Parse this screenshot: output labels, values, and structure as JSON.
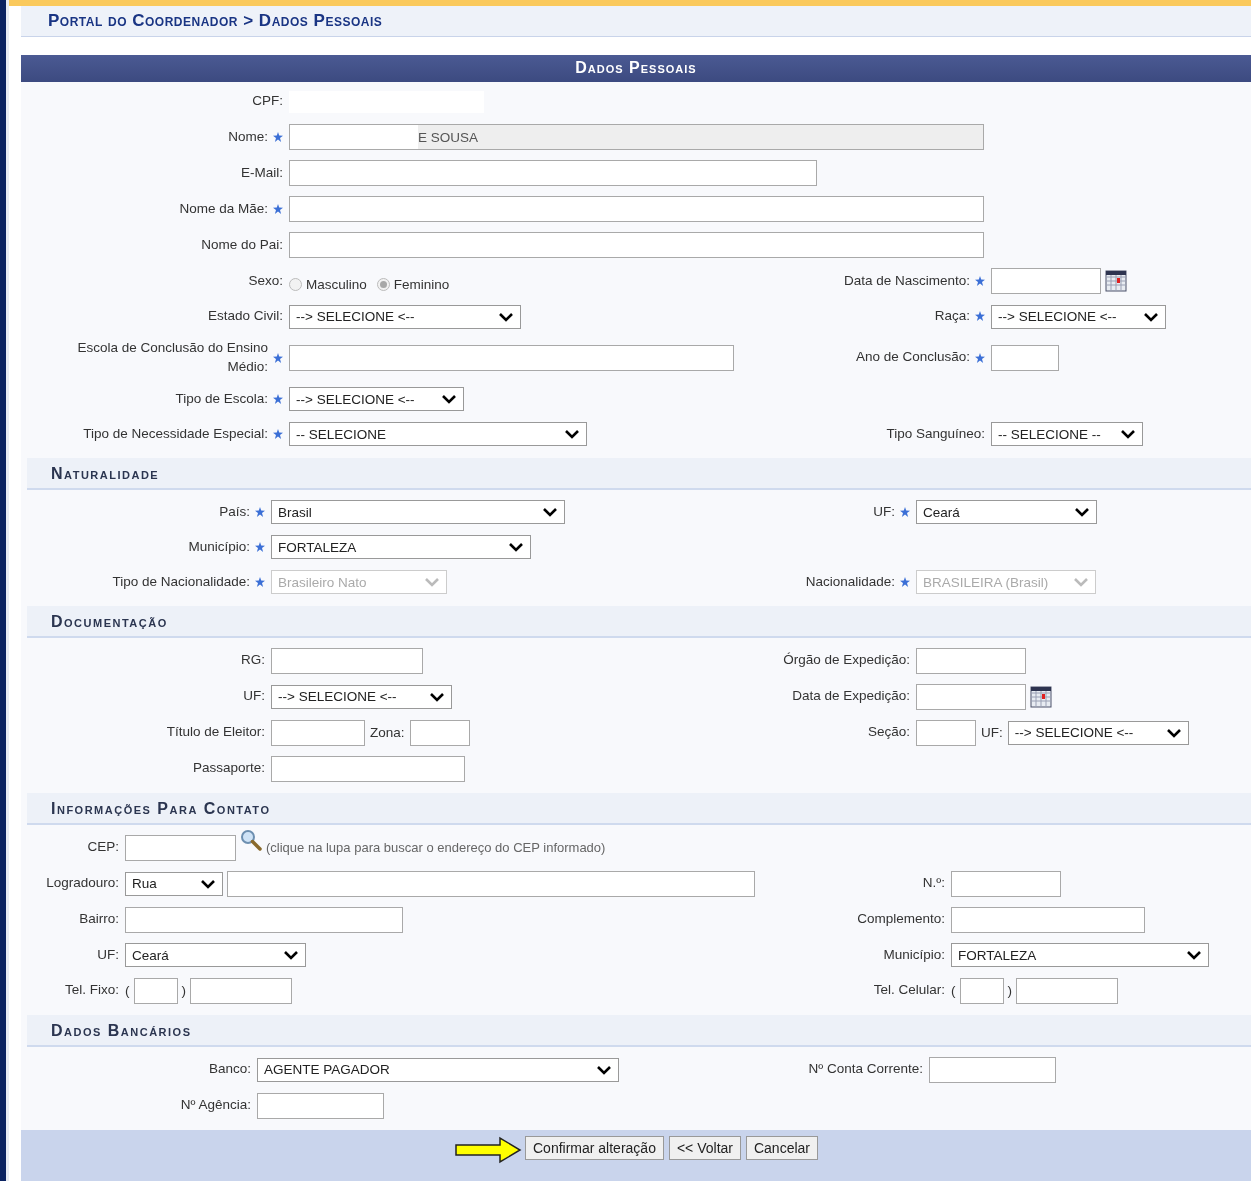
{
  "breadcrumb": "Portal do Coordenador > Dados Pessoais",
  "form_title": "Dados Pessoais",
  "sections": [
    {
      "rows": [
        {
          "left": {
            "label": "CPF:",
            "required": false,
            "controls": [
              {
                "kind": "redacted"
              }
            ]
          }
        },
        {
          "left": {
            "label": "Nome:",
            "required": true,
            "controls": [
              {
                "kind": "readonly",
                "value": "E SOUSA"
              }
            ]
          }
        },
        {
          "left": {
            "label": "E-Mail:",
            "required": false,
            "controls": [
              {
                "kind": "text"
              }
            ]
          }
        },
        {
          "left": {
            "label": "Nome da Mãe:",
            "required": true,
            "controls": [
              {
                "kind": "text"
              }
            ]
          }
        },
        {
          "left": {
            "label": "Nome do Pai:",
            "required": false,
            "controls": [
              {
                "kind": "text"
              }
            ]
          }
        },
        {
          "left": {
            "label": "Sexo:",
            "required": false,
            "controls": [
              {
                "kind": "radio",
                "label": "Masculino",
                "selected": false
              },
              {
                "kind": "radio",
                "label": "Feminino",
                "selected": true
              }
            ]
          },
          "right": {
            "label": "Data de Nascimento:",
            "required": true,
            "controls": [
              {
                "kind": "text"
              },
              {
                "kind": "calendar"
              }
            ]
          }
        },
        {
          "left": {
            "label": "Estado Civil:",
            "required": false,
            "controls": [
              {
                "kind": "select",
                "value": "--> SELECIONE <--",
                "disabled": false
              }
            ]
          },
          "right": {
            "label": "Raça:",
            "required": true,
            "controls": [
              {
                "kind": "select",
                "value": "--> SELECIONE <--",
                "disabled": false
              }
            ]
          }
        },
        {
          "left": {
            "label": "Escola de Conclusão do Ensino Médio:",
            "required": true,
            "controls": [
              {
                "kind": "text"
              }
            ]
          },
          "right": {
            "label": "Ano de Conclusão:",
            "required": true,
            "controls": [
              {
                "kind": "text"
              }
            ]
          }
        },
        {
          "left": {
            "label": "Tipo de Escola:",
            "required": true,
            "controls": [
              {
                "kind": "select",
                "value": "--> SELECIONE <--",
                "disabled": false
              }
            ]
          }
        },
        {
          "left": {
            "label": "Tipo de Necessidade Especial:",
            "required": true,
            "controls": [
              {
                "kind": "select",
                "value": "-- SELECIONE",
                "disabled": false
              }
            ]
          },
          "right": {
            "label": "Tipo Sanguíneo:",
            "required": false,
            "controls": [
              {
                "kind": "select",
                "value": "-- SELECIONE --",
                "disabled": false
              }
            ]
          }
        }
      ]
    },
    {
      "title": "Naturalidade",
      "rows": [
        {
          "left": {
            "label": "País:",
            "required": true,
            "controls": [
              {
                "kind": "select",
                "value": "Brasil",
                "disabled": false
              }
            ]
          },
          "right": {
            "label": "UF:",
            "required": true,
            "controls": [
              {
                "kind": "select",
                "value": "Ceará",
                "disabled": false
              }
            ]
          }
        },
        {
          "left": {
            "label": "Município:",
            "required": true,
            "controls": [
              {
                "kind": "select",
                "value": "FORTALEZA",
                "disabled": false
              }
            ]
          }
        },
        {
          "left": {
            "label": "Tipo de Nacionalidade:",
            "required": true,
            "controls": [
              {
                "kind": "select",
                "value": "Brasileiro Nato",
                "disabled": true
              }
            ]
          },
          "right": {
            "label": "Nacionalidade:",
            "required": true,
            "controls": [
              {
                "kind": "select",
                "value": "BRASILEIRA (Brasil)",
                "disabled": true
              }
            ]
          }
        }
      ]
    },
    {
      "title": "Documentação",
      "rows": [
        {
          "left": {
            "label": "RG:",
            "required": false,
            "controls": [
              {
                "kind": "text"
              }
            ]
          },
          "right": {
            "label": "Órgão de Expedição:",
            "required": false,
            "controls": [
              {
                "kind": "text"
              }
            ]
          }
        },
        {
          "left": {
            "label": "UF:",
            "required": false,
            "controls": [
              {
                "kind": "select",
                "value": "--> SELECIONE <--",
                "disabled": false
              }
            ]
          },
          "right": {
            "label": "Data de Expedição:",
            "required": false,
            "controls": [
              {
                "kind": "text"
              },
              {
                "kind": "calendar"
              }
            ]
          }
        },
        {
          "left": {
            "label": "Título de Eleitor:",
            "required": false,
            "controls": [
              {
                "kind": "text"
              },
              {
                "kind": "inline_label",
                "text": "Zona:"
              },
              {
                "kind": "text"
              }
            ]
          },
          "right": {
            "label": "Seção:",
            "required": false,
            "controls": [
              {
                "kind": "text"
              },
              {
                "kind": "inline_label",
                "text": "UF:"
              },
              {
                "kind": "select",
                "value": "--> SELECIONE <--",
                "disabled": false
              }
            ]
          }
        },
        {
          "left": {
            "label": "Passaporte:",
            "required": false,
            "controls": [
              {
                "kind": "text"
              }
            ]
          }
        }
      ]
    },
    {
      "title": "Informações Para Contato",
      "rows": [
        {
          "left": {
            "label": "CEP:",
            "required": false,
            "controls": [
              {
                "kind": "text"
              },
              {
                "kind": "search"
              },
              {
                "kind": "hint",
                "text": "(clique na lupa para buscar o endereço do CEP informado)"
              }
            ]
          }
        },
        {
          "left": {
            "label": "Logradouro:",
            "required": false,
            "controls": [
              {
                "kind": "select",
                "value": "Rua",
                "disabled": false
              },
              {
                "kind": "text"
              }
            ]
          },
          "right": {
            "label": "N.º:",
            "required": false,
            "controls": [
              {
                "kind": "text"
              }
            ]
          }
        },
        {
          "left": {
            "label": "Bairro:",
            "required": false,
            "controls": [
              {
                "kind": "text"
              }
            ]
          },
          "right": {
            "label": "Complemento:",
            "required": false,
            "controls": [
              {
                "kind": "text"
              }
            ]
          }
        },
        {
          "left": {
            "label": "UF:",
            "required": false,
            "controls": [
              {
                "kind": "select",
                "value": "Ceará",
                "disabled": false
              }
            ]
          },
          "right": {
            "label": "Município:",
            "required": false,
            "controls": [
              {
                "kind": "select",
                "value": "FORTALEZA",
                "disabled": false
              }
            ]
          }
        },
        {
          "left": {
            "label": "Tel. Fixo:",
            "required": false,
            "controls": [
              {
                "kind": "punct",
                "text": "("
              },
              {
                "kind": "text"
              },
              {
                "kind": "punct",
                "text": ")"
              },
              {
                "kind": "text"
              }
            ]
          },
          "right": {
            "label": "Tel. Celular:",
            "required": false,
            "controls": [
              {
                "kind": "punct",
                "text": "("
              },
              {
                "kind": "text"
              },
              {
                "kind": "punct",
                "text": ")"
              },
              {
                "kind": "text"
              }
            ]
          }
        }
      ]
    },
    {
      "title": "Dados Bancários",
      "rows": [
        {
          "left": {
            "label": "Banco:",
            "required": false,
            "controls": [
              {
                "kind": "select",
                "value": "AGENTE PAGADOR",
                "disabled": false
              }
            ]
          },
          "right": {
            "label": "Nº Conta Corrente:",
            "required": false,
            "controls": [
              {
                "kind": "text"
              }
            ]
          }
        },
        {
          "left": {
            "label": "Nº Agência:",
            "required": false,
            "controls": [
              {
                "kind": "text"
              }
            ]
          }
        }
      ]
    }
  ],
  "buttons": [
    "Confirmar alteração",
    "<< Voltar",
    "Cancelar"
  ]
}
